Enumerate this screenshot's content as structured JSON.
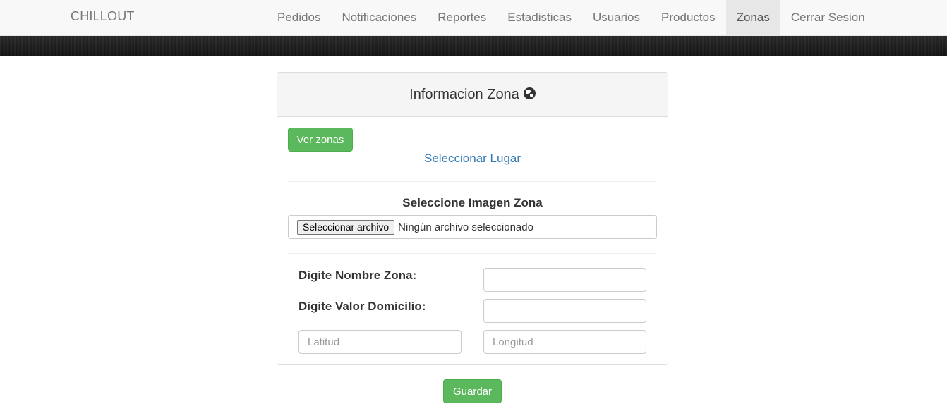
{
  "navbar": {
    "brand": "CHILLOUT",
    "items": [
      {
        "label": "Pedidos"
      },
      {
        "label": "Notificaciones"
      },
      {
        "label": "Reportes"
      },
      {
        "label": "Estadisticas"
      },
      {
        "label": "Usuarios"
      },
      {
        "label": "Productos"
      },
      {
        "label": "Zonas",
        "active": true
      },
      {
        "label": "Cerrar Sesion"
      }
    ]
  },
  "panel": {
    "title": "Informacion Zona",
    "title_icon": "globe-icon",
    "ver_zonas_label": "Ver zonas",
    "select_place_link": "Seleccionar Lugar",
    "image_label": "Seleccione Imagen Zona",
    "file_button_label": "Seleccionar archivo",
    "file_status": "Ningún archivo seleccionado",
    "nombre_label": "Digite Nombre Zona:",
    "nombre_value": "",
    "valor_label": "Digite Valor Domicilio:",
    "valor_value": "",
    "latitud_placeholder": "Latitud",
    "longitud_placeholder": "Longitud"
  },
  "save_button_label": "Guardar",
  "colors": {
    "success": "#5cb85c",
    "link": "#337ab7",
    "navbar_bg": "#f8f8f8",
    "nav_active_bg": "#e7e7e7"
  }
}
